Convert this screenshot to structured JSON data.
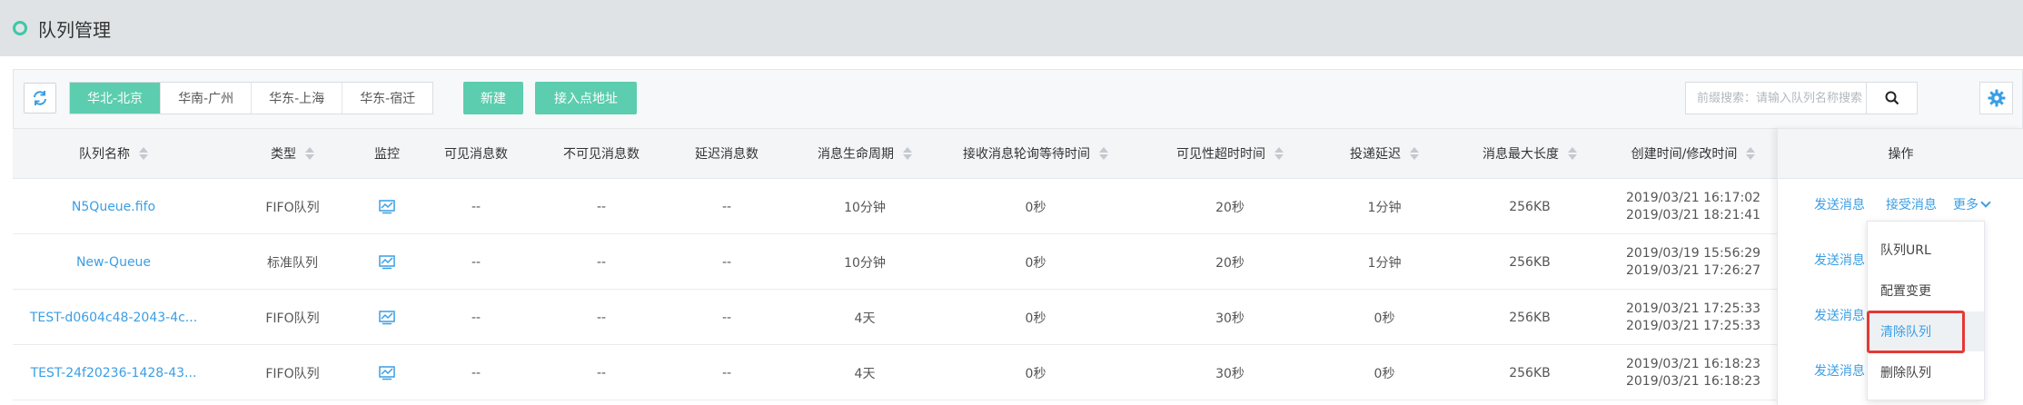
{
  "header": {
    "title": "队列管理"
  },
  "toolbar": {
    "regions": [
      "华北-北京",
      "华南-广州",
      "华东-上海",
      "华东-宿迁"
    ],
    "active_region": "华北-北京",
    "new_label": "新建",
    "endpoint_label": "接入点地址",
    "search_placeholder": "前缀搜索：请输入队列名称搜索"
  },
  "table": {
    "columns": [
      "队列名称",
      "类型",
      "监控",
      "可见消息数",
      "不可见消息数",
      "延迟消息数",
      "消息生命周期",
      "接收消息轮询等待时间",
      "可见性超时时间",
      "投递延迟",
      "消息最大长度",
      "创建时间/修改时间",
      "操作"
    ],
    "rows": [
      {
        "name": "N5Queue.fifo",
        "type": "FIFO队列",
        "visible": "--",
        "invisible": "--",
        "delayed": "--",
        "lifecycle": "10分钟",
        "wait": "0秒",
        "timeout": "20秒",
        "delay": "1分钟",
        "maxlen": "256KB",
        "created": "2019/03/21 16:17:02",
        "modified": "2019/03/21 18:21:41"
      },
      {
        "name": "New-Queue",
        "type": "标准队列",
        "visible": "--",
        "invisible": "--",
        "delayed": "--",
        "lifecycle": "10分钟",
        "wait": "0秒",
        "timeout": "20秒",
        "delay": "1分钟",
        "maxlen": "256KB",
        "created": "2019/03/19 15:56:29",
        "modified": "2019/03/21 17:26:27"
      },
      {
        "name": "TEST-d0604c48-2043-4c...",
        "type": "FIFO队列",
        "visible": "--",
        "invisible": "--",
        "delayed": "--",
        "lifecycle": "4天",
        "wait": "0秒",
        "timeout": "30秒",
        "delay": "0秒",
        "maxlen": "256KB",
        "created": "2019/03/21 17:25:33",
        "modified": "2019/03/21 17:25:33"
      },
      {
        "name": "TEST-24f20236-1428-43...",
        "type": "FIFO队列",
        "visible": "--",
        "invisible": "--",
        "delayed": "--",
        "lifecycle": "4天",
        "wait": "0秒",
        "timeout": "30秒",
        "delay": "0秒",
        "maxlen": "256KB",
        "created": "2019/03/21 16:18:23",
        "modified": "2019/03/21 16:18:23"
      }
    ]
  },
  "operations": {
    "send": "发送消息",
    "receive": "接受消息",
    "more": "更多"
  },
  "dropdown": {
    "items": [
      "队列URL",
      "配置变更",
      "清除队列",
      "删除队列"
    ],
    "highlighted": "清除队列"
  },
  "colors": {
    "accent": "#5ccdaf",
    "link": "#3a9ee4",
    "highlight": "#e53935"
  },
  "icons": {
    "refresh": "refresh-icon",
    "search": "search-icon",
    "settings": "gear-icon",
    "monitor": "monitor-chart-icon"
  }
}
